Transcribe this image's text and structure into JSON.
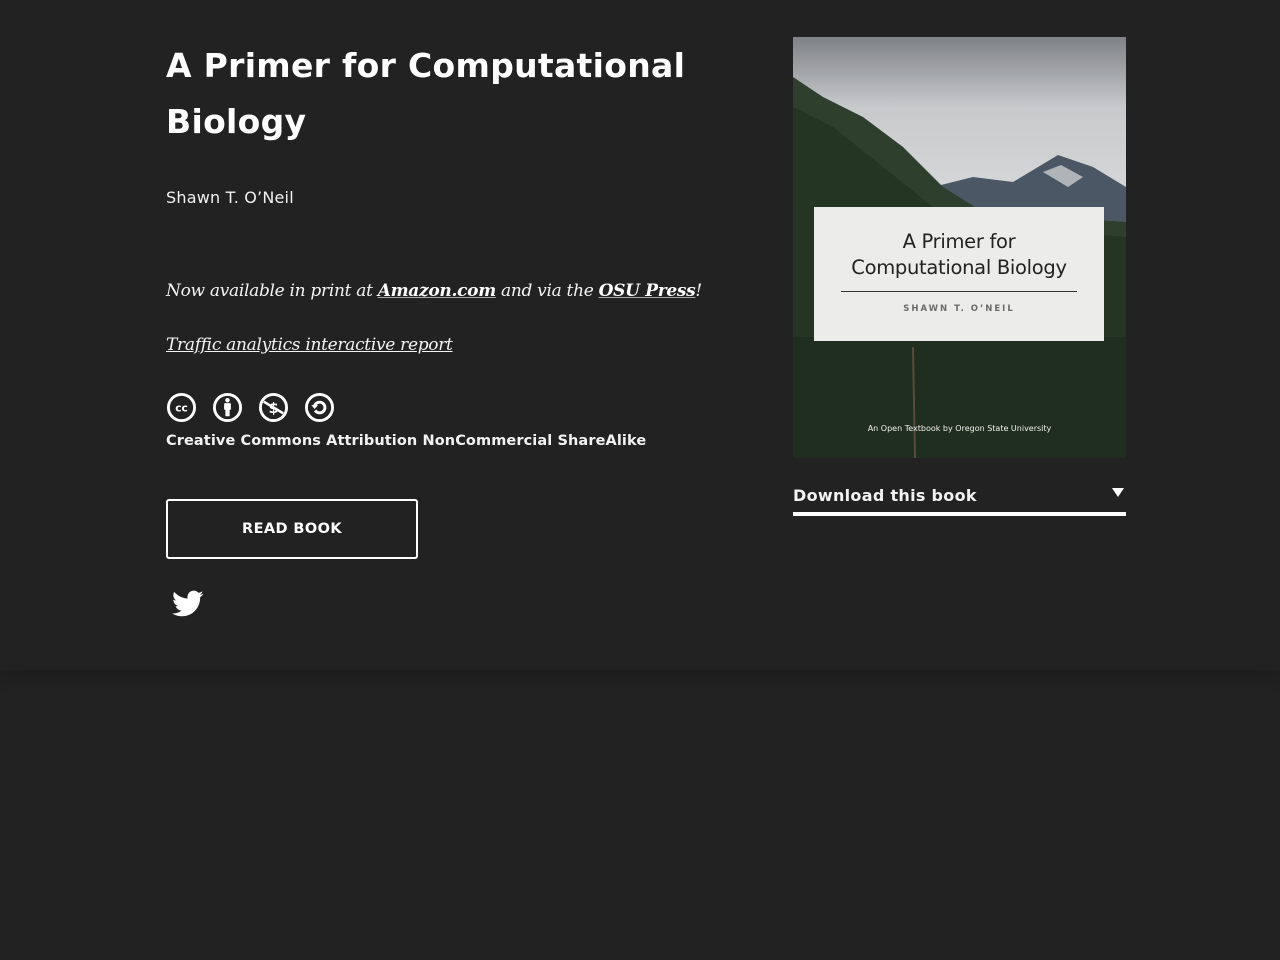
{
  "book": {
    "title": "A Primer for Computational Biology",
    "author": "Shawn T. O’Neil"
  },
  "promo": {
    "prefix": "Now available in print at ",
    "amazon_link": "Amazon.com",
    "middle": " and via the ",
    "osu_link": "OSU Press",
    "suffix": "!"
  },
  "analytics_link": "Traffic analytics interactive report",
  "license": {
    "icons": [
      "cc-icon",
      "attribution-icon",
      "noncommercial-icon",
      "sharealike-icon"
    ],
    "text": "Creative Commons Attribution NonCommercial ShareAlike"
  },
  "actions": {
    "read_book": "READ BOOK",
    "share_icon": "twitter-icon"
  },
  "cover": {
    "title_line1": "A Primer for",
    "title_line2": "Computational Biology",
    "author": "SHAWN T. O’NEIL",
    "footer": "An Open Textbook by Oregon State University"
  },
  "download": {
    "label": "Download this book",
    "icon": "caret-down-icon"
  },
  "colors": {
    "background": "#222222",
    "text": "#ffffff"
  }
}
